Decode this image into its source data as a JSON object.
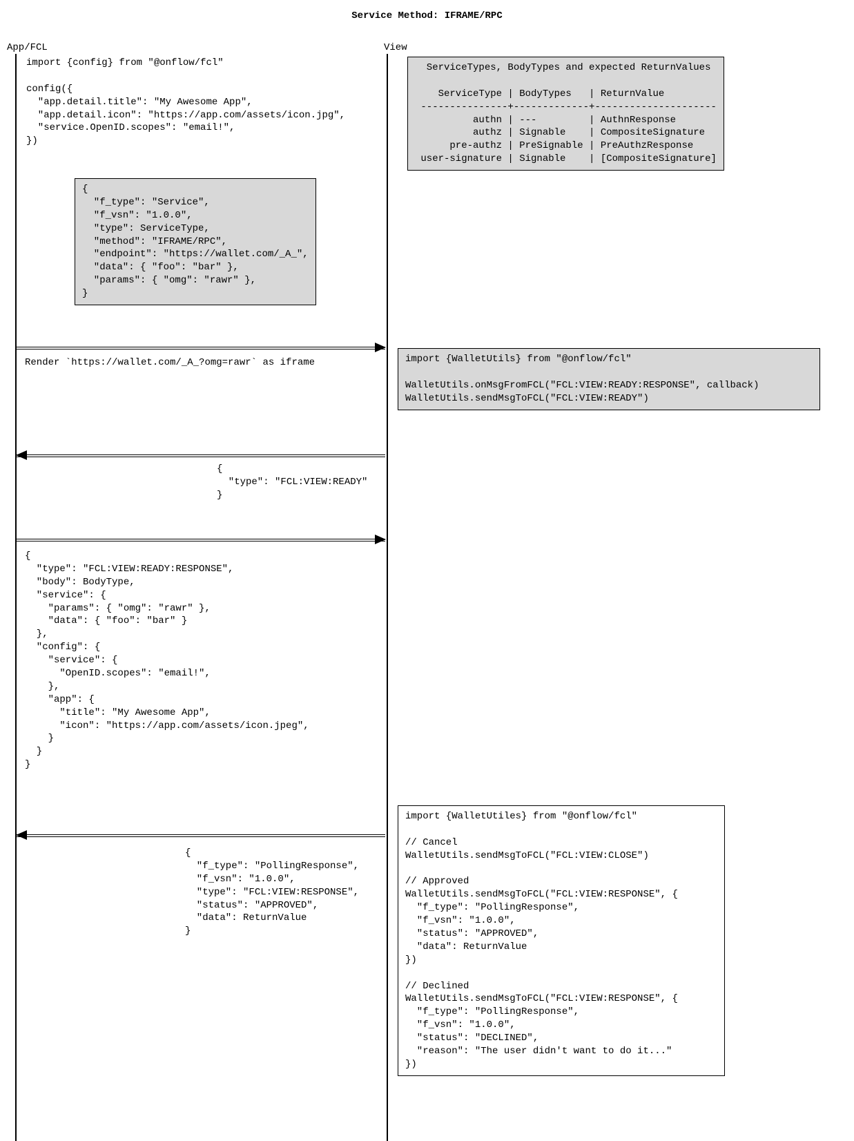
{
  "title": "Service Method: IFRAME/RPC",
  "lanes": {
    "left": "App/FCL",
    "right": "View"
  },
  "boxes": {
    "config_code": "import {config} from \"@onflow/fcl\"\n\nconfig({\n  \"app.detail.title\": \"My Awesome App\",\n  \"app.detail.icon\": \"https://app.com/assets/icon.jpg\",\n  \"service.OpenID.scopes\": \"email!\",\n})",
    "service_json": "{\n  \"f_type\": \"Service\",\n  \"f_vsn\": \"1.0.0\",\n  \"type\": ServiceType,\n  \"method\": \"IFRAME/RPC\",\n  \"endpoint\": \"https://wallet.com/_A_\",\n  \"data\": { \"foo\": \"bar\" },\n  \"params\": { \"omg\": \"rawr\" },\n}",
    "service_table": "  ServiceTypes, BodyTypes and expected ReturnValues\n\n    ServiceType | BodyTypes   | ReturnValue\n ---------------+-------------+---------------------\n          authn | ---         | AuthnResponse\n          authz | Signable    | CompositeSignature\n      pre-authz | PreSignable | PreAuthzResponse\n user-signature | Signable    | [CompositeSignature]",
    "render_label": "Render `https://wallet.com/_A_?omg=rawr` as iframe",
    "wallet_utils_1": "import {WalletUtils} from \"@onflow/fcl\"\n\nWalletUtils.onMsgFromFCL(\"FCL:VIEW:READY:RESPONSE\", callback)\nWalletUtils.sendMsgToFCL(\"FCL:VIEW:READY\")",
    "view_ready": "{\n  \"type\": \"FCL:VIEW:READY\"\n}",
    "ready_response": "{\n  \"type\": \"FCL:VIEW:READY:RESPONSE\",\n  \"body\": BodyType,\n  \"service\": {\n    \"params\": { \"omg\": \"rawr\" },\n    \"data\": { \"foo\": \"bar\" }\n  },\n  \"config\": {\n    \"service\": {\n      \"OpenID.scopes\": \"email!\",\n    },\n    \"app\": {\n      \"title\": \"My Awesome App\",\n      \"icon\": \"https://app.com/assets/icon.jpeg\",\n    }\n  }\n}",
    "polling_response": "{\n  \"f_type\": \"PollingResponse\",\n  \"f_vsn\": \"1.0.0\",\n  \"type\": \"FCL:VIEW:RESPONSE\",\n  \"status\": \"APPROVED\",\n  \"data\": ReturnValue\n}",
    "wallet_utils_2": "import {WalletUtiles} from \"@onflow/fcl\"\n\n// Cancel\nWalletUtils.sendMsgToFCL(\"FCL:VIEW:CLOSE\")\n\n// Approved\nWalletUtils.sendMsgToFCL(\"FCL:VIEW:RESPONSE\", {\n  \"f_type\": \"PollingResponse\",\n  \"f_vsn\": \"1.0.0\",\n  \"status\": \"APPROVED\",\n  \"data\": ReturnValue\n})\n\n// Declined\nWalletUtils.sendMsgToFCL(\"FCL:VIEW:RESPONSE\", {\n  \"f_type\": \"PollingResponse\",\n  \"f_vsn\": \"1.0.0\",\n  \"status\": \"DECLINED\",\n  \"reason\": \"The user didn't want to do it...\"\n})"
  },
  "chart_data": {
    "type": "table",
    "title": "ServiceTypes, BodyTypes and expected ReturnValues",
    "columns": [
      "ServiceType",
      "BodyTypes",
      "ReturnValue"
    ],
    "rows": [
      [
        "authn",
        "---",
        "AuthnResponse"
      ],
      [
        "authz",
        "Signable",
        "CompositeSignature"
      ],
      [
        "pre-authz",
        "PreSignable",
        "PreAuthzResponse"
      ],
      [
        "user-signature",
        "Signable",
        "[CompositeSignature]"
      ]
    ]
  },
  "sequence": [
    {
      "step": 1,
      "from": "App/FCL",
      "to": "View",
      "label": "Render `https://wallet.com/_A_?omg=rawr` as iframe"
    },
    {
      "step": 2,
      "from": "View",
      "to": "App/FCL",
      "message": {
        "type": "FCL:VIEW:READY"
      }
    },
    {
      "step": 3,
      "from": "App/FCL",
      "to": "View",
      "message": "FCL:VIEW:READY:RESPONSE"
    },
    {
      "step": 4,
      "from": "View",
      "to": "App/FCL",
      "message": "FCL:VIEW:RESPONSE (PollingResponse)"
    }
  ]
}
